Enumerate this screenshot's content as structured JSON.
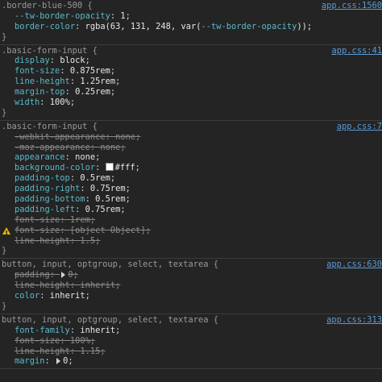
{
  "rules": [
    {
      "selector": ".border-blue-500 {",
      "source": "app.css:1560",
      "decls": [
        {
          "prop": "--tw-border-opacity",
          "value": "1",
          "struck": false
        },
        {
          "prop": "border-color",
          "value_pre": "rgba(63, 131, 248, var(",
          "var": "--tw-border-opacity",
          "value_post": "));",
          "struck": false
        }
      ],
      "close": "}"
    },
    {
      "selector": ".basic-form-input {",
      "source": "app.css:41",
      "decls": [
        {
          "prop": "display",
          "value": "block",
          "struck": false
        },
        {
          "prop": "font-size",
          "value": "0.875rem",
          "struck": false
        },
        {
          "prop": "line-height",
          "value": "1.25rem",
          "struck": false
        },
        {
          "prop": "margin-top",
          "value": "0.25rem",
          "struck": false
        },
        {
          "prop": "width",
          "value": "100%",
          "struck": false
        }
      ],
      "close": "}"
    },
    {
      "selector": ".basic-form-input {",
      "source": "app.css:7",
      "decls": [
        {
          "prop": "-webkit-appearance",
          "value": "none",
          "struck": true
        },
        {
          "prop": "-moz-appearance",
          "value": "none",
          "struck": true
        },
        {
          "prop": "appearance",
          "value": "none",
          "struck": false
        },
        {
          "prop": "background-color",
          "value": "#fff",
          "struck": false,
          "swatch": "#ffffff"
        },
        {
          "prop": "padding-top",
          "value": "0.5rem",
          "struck": false
        },
        {
          "prop": "padding-right",
          "value": "0.75rem",
          "struck": false
        },
        {
          "prop": "padding-bottom",
          "value": "0.5rem",
          "struck": false
        },
        {
          "prop": "padding-left",
          "value": "0.75rem",
          "struck": false
        },
        {
          "prop": "font-size",
          "value": "1rem",
          "struck": true
        },
        {
          "prop": "font-size",
          "value": "[object Object]",
          "struck": true,
          "warning": true
        },
        {
          "prop": "line-height",
          "value": "1.5",
          "struck": true
        }
      ],
      "close": "}"
    },
    {
      "selector": "button, input, optgroup, select, textarea {",
      "source": "app.css:630",
      "decls": [
        {
          "prop": "padding",
          "value": "0",
          "struck": true,
          "expand": true
        },
        {
          "prop": "line-height",
          "value": "inherit",
          "struck": true
        },
        {
          "prop": "color",
          "value": "inherit",
          "struck": false
        }
      ],
      "close": "}"
    },
    {
      "selector": "button, input, optgroup, select, textarea {",
      "source": "app.css:313",
      "decls": [
        {
          "prop": "font-family",
          "value": "inherit",
          "struck": false
        },
        {
          "prop": "font-size",
          "value": "100%",
          "struck": true
        },
        {
          "prop": "line-height",
          "value": "1.15",
          "struck": true
        },
        {
          "prop": "margin",
          "value": "0",
          "struck": false,
          "expand": true
        }
      ],
      "close": ""
    }
  ]
}
